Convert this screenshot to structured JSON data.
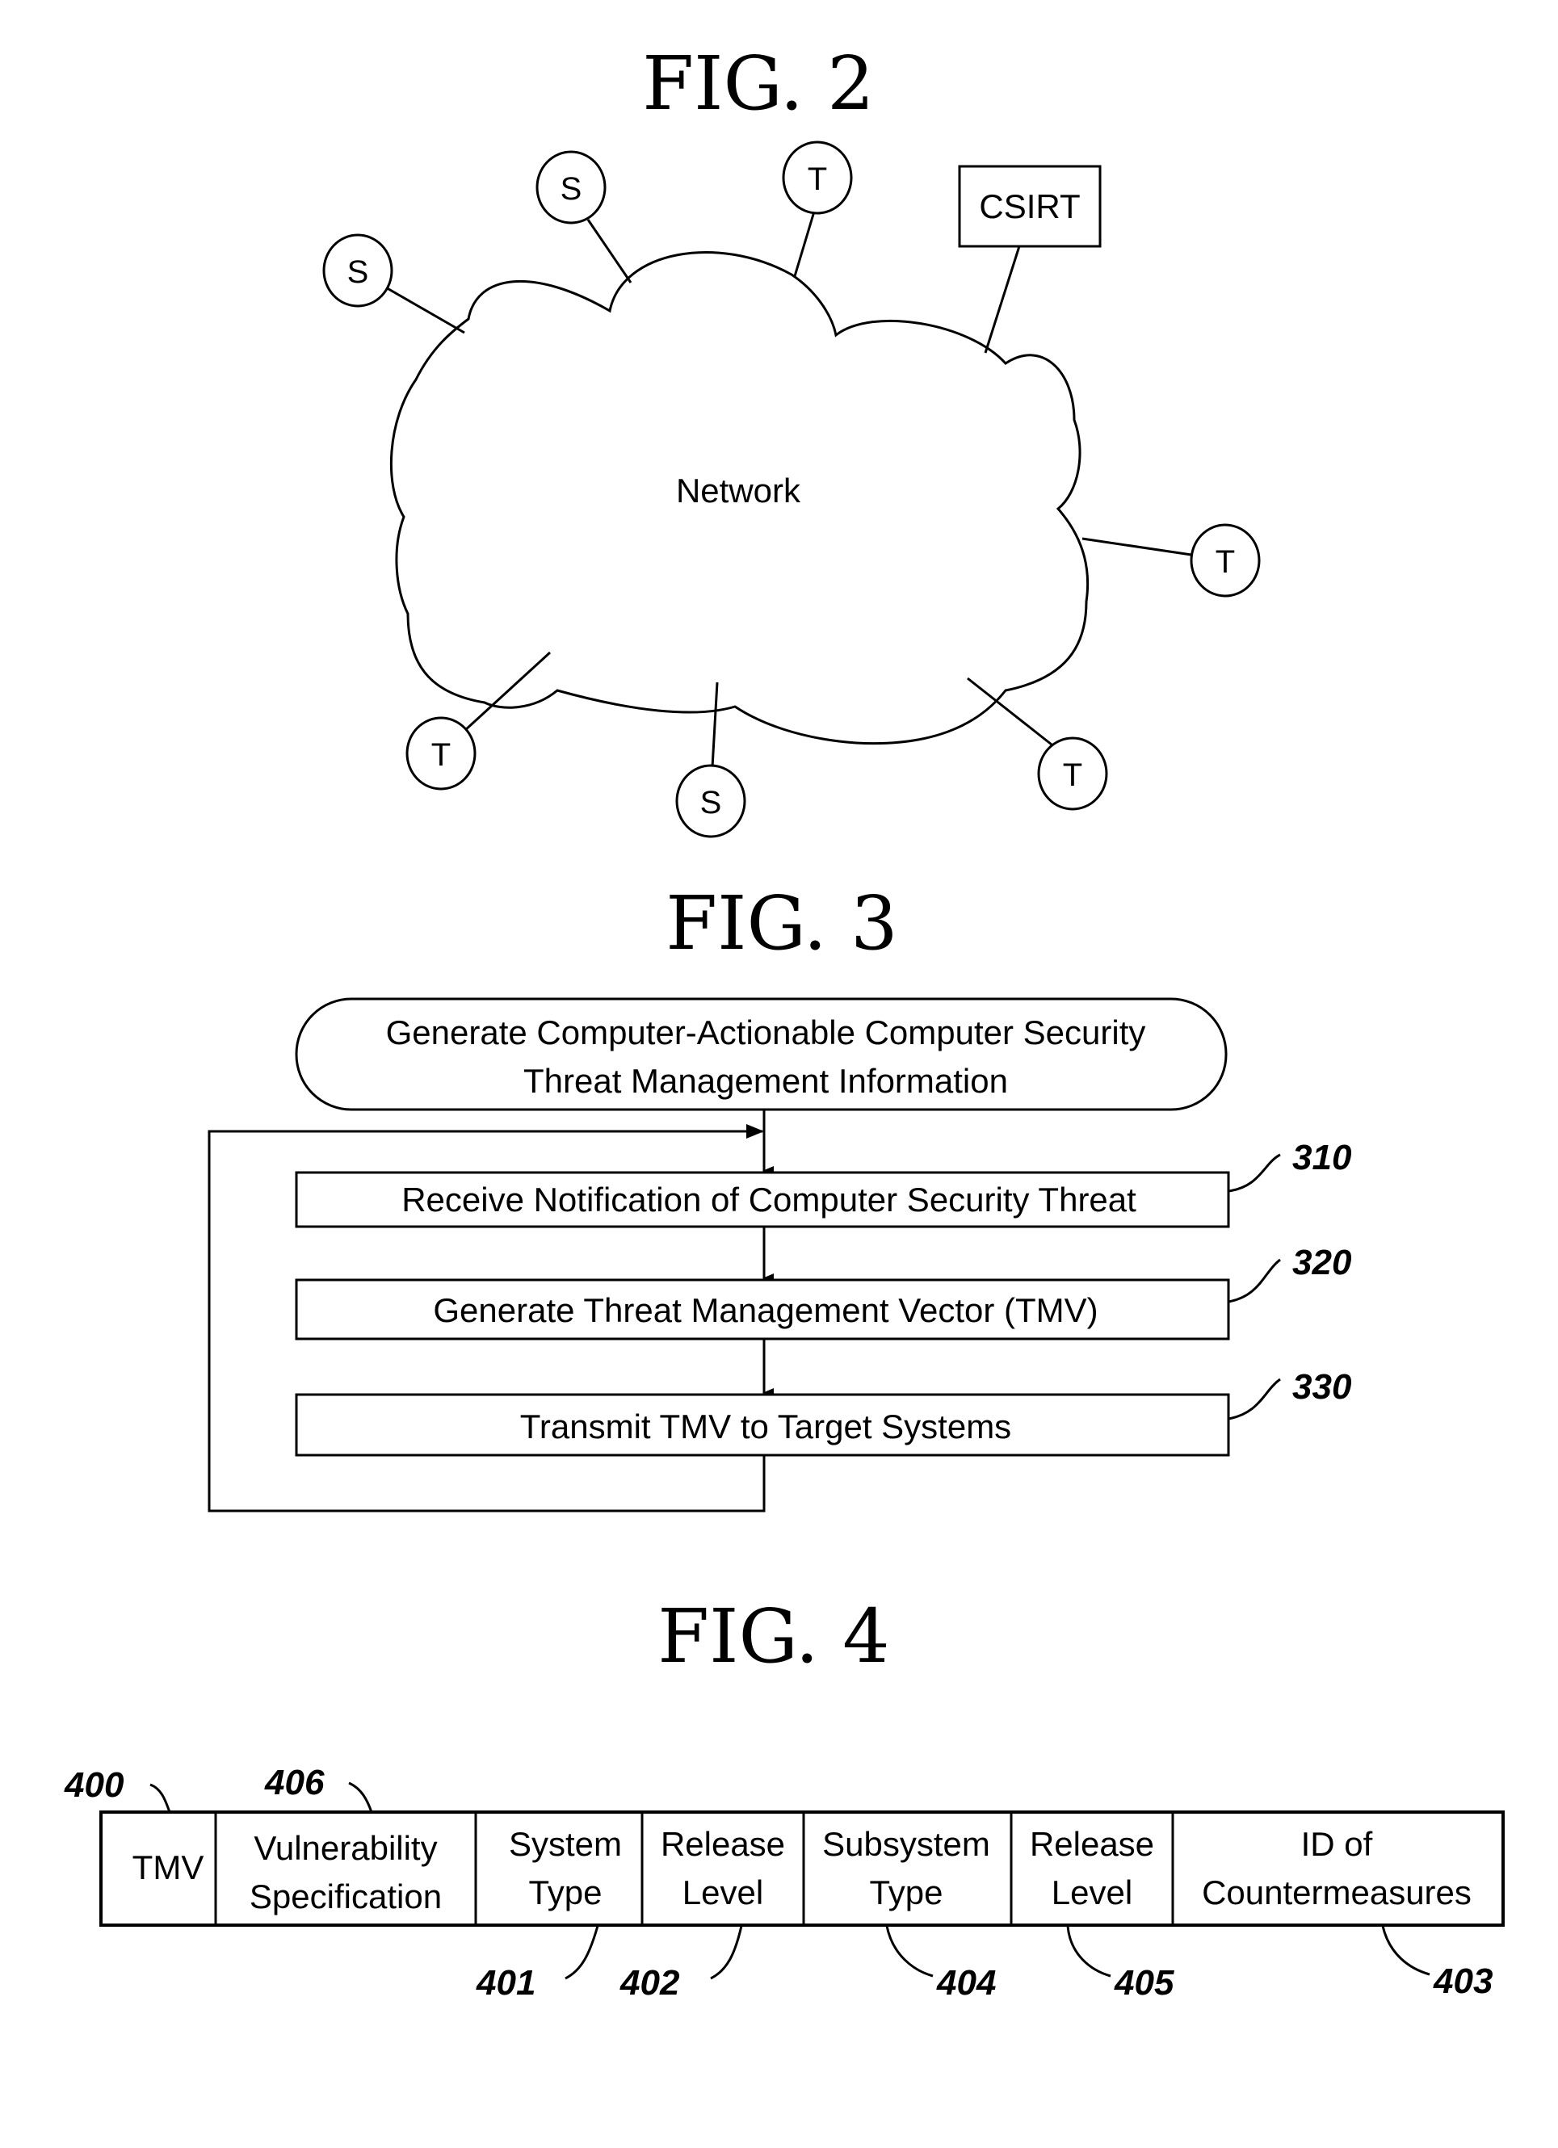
{
  "fig2": {
    "title": "FIG. 2",
    "network_label": "Network",
    "nodes": [
      {
        "type": "S",
        "label": "S"
      },
      {
        "type": "S",
        "label": "S"
      },
      {
        "type": "T",
        "label": "T"
      },
      {
        "type": "CSIRT",
        "label": "CSIRT"
      },
      {
        "type": "T",
        "label": "T"
      },
      {
        "type": "T",
        "label": "T"
      },
      {
        "type": "S",
        "label": "S"
      },
      {
        "type": "T",
        "label": "T"
      }
    ]
  },
  "fig3": {
    "title": "FIG. 3",
    "start": {
      "line1": "Generate Computer-Actionable Computer Security",
      "line2": "Threat Management Information"
    },
    "steps": [
      {
        "ref": "310",
        "label": "Receive Notification of Computer Security Threat"
      },
      {
        "ref": "320",
        "label": "Generate Threat Management Vector (TMV)"
      },
      {
        "ref": "330",
        "label": "Transmit TMV to Target Systems"
      }
    ]
  },
  "fig4": {
    "title": "FIG. 4",
    "ref_top": [
      "400",
      "406"
    ],
    "fields": [
      {
        "line1": "TMV",
        "line2": ""
      },
      {
        "line1": "Vulnerability",
        "line2": "Specification"
      },
      {
        "line1": "System",
        "line2": "Type"
      },
      {
        "line1": "Release",
        "line2": "Level"
      },
      {
        "line1": "Subsystem",
        "line2": "Type"
      },
      {
        "line1": "Release",
        "line2": "Level"
      },
      {
        "line1": "ID of",
        "line2": "Countermeasures"
      }
    ],
    "ref_bottom": [
      "401",
      "402",
      "404",
      "405",
      "403"
    ]
  }
}
